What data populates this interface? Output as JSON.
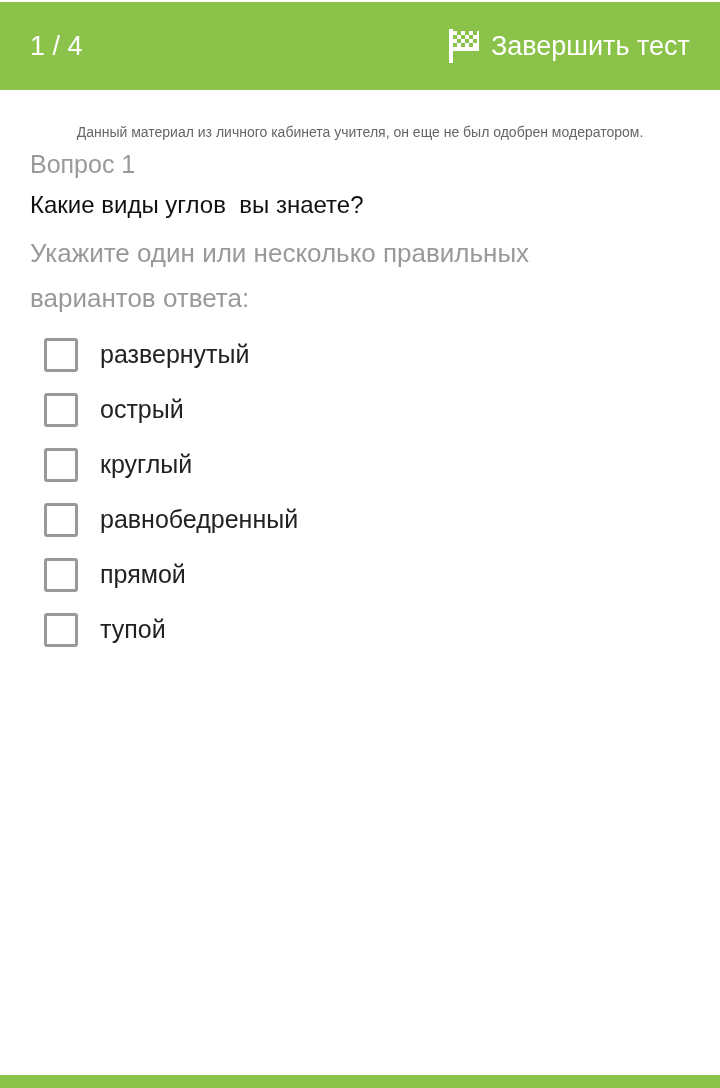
{
  "header": {
    "counter": "1 / 4",
    "finish_button": "Завершить тест"
  },
  "notice": "Данный материал из личного кабинета учителя, он еще не был одобрен модератором.",
  "question": {
    "label": "Вопрос 1",
    "text": "Какие виды углов  вы знаете?",
    "instruction": "Укажите один или несколько правильных вариантов ответа:"
  },
  "options": [
    {
      "label": "развернутый",
      "checked": false
    },
    {
      "label": "острый",
      "checked": false
    },
    {
      "label": "круглый",
      "checked": false
    },
    {
      "label": "равнобедренный",
      "checked": false
    },
    {
      "label": "прямой",
      "checked": false
    },
    {
      "label": "тупой",
      "checked": false
    }
  ]
}
